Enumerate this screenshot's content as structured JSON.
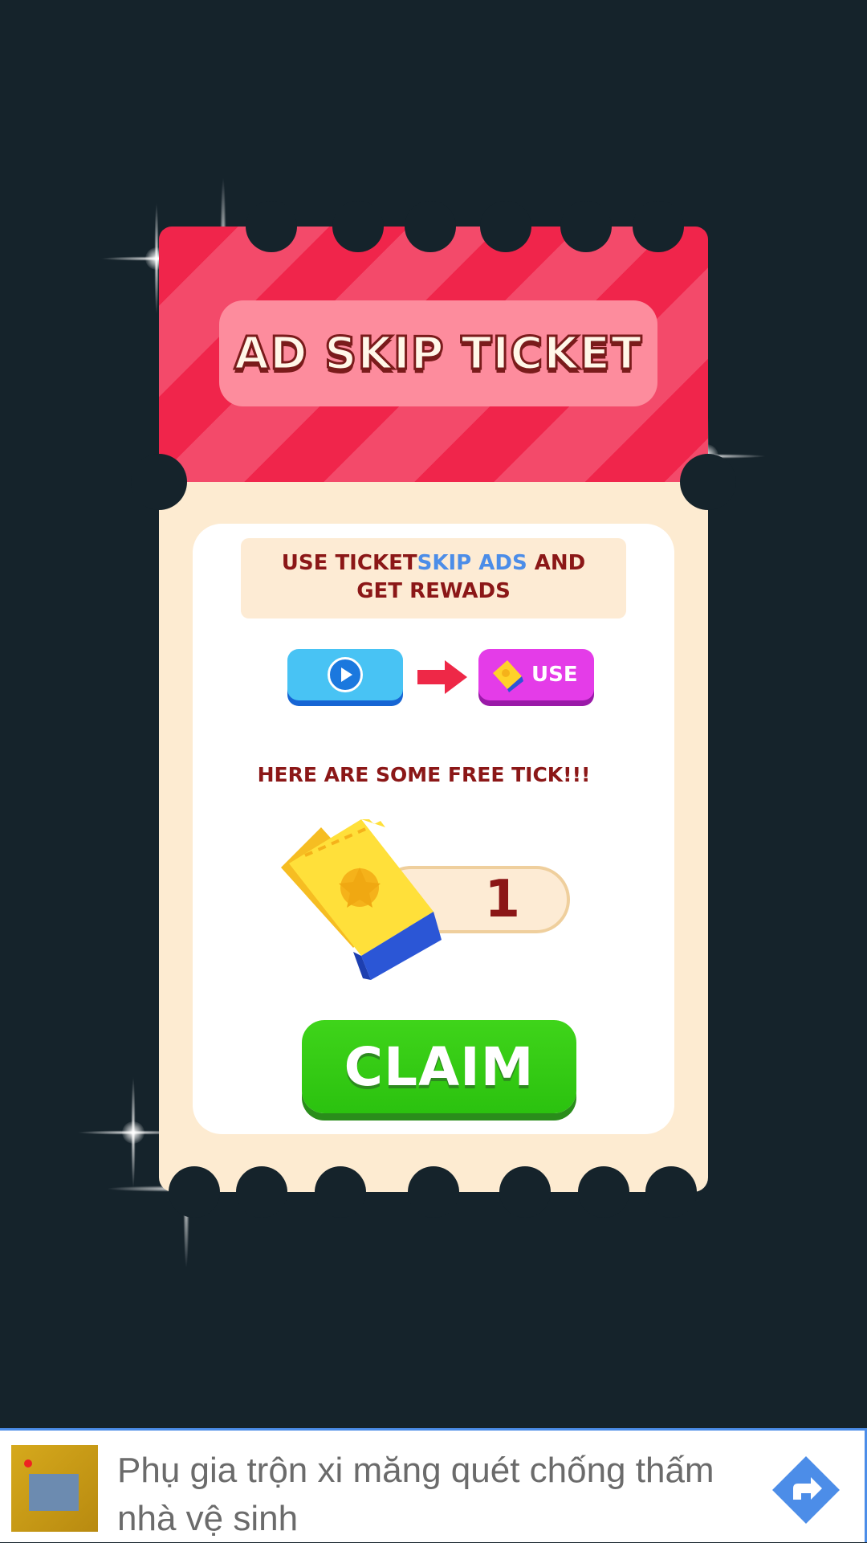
{
  "ticket": {
    "title": "AD SKIP TICKET",
    "info_line1_a": "USE TICKET",
    "info_line1_b": "SKIP ADS",
    "info_line1_c": " AND",
    "info_line2": "GET REWADS",
    "use_label": "USE",
    "free_text": "HERE ARE SOME FREE TICK!!!",
    "ticket_count": "1",
    "claim_label": "CLAIM"
  },
  "ad": {
    "text": "Phụ gia trộn xi măng quét chống thấm nhà vệ sinh"
  },
  "colors": {
    "background": "#15232b",
    "ticket_top": "#f0254b",
    "ticket_body": "#fdebd1",
    "claim": "#2bc20f",
    "video_button": "#48c3f4",
    "use_button": "#e43ce8",
    "text_dark_red": "#8b1717",
    "highlight_blue": "#4c8de8"
  },
  "icons": {
    "video": "play-icon",
    "arrow": "arrow-right-icon",
    "ticket": "ticket-icon",
    "ad_cta": "directions-icon"
  }
}
